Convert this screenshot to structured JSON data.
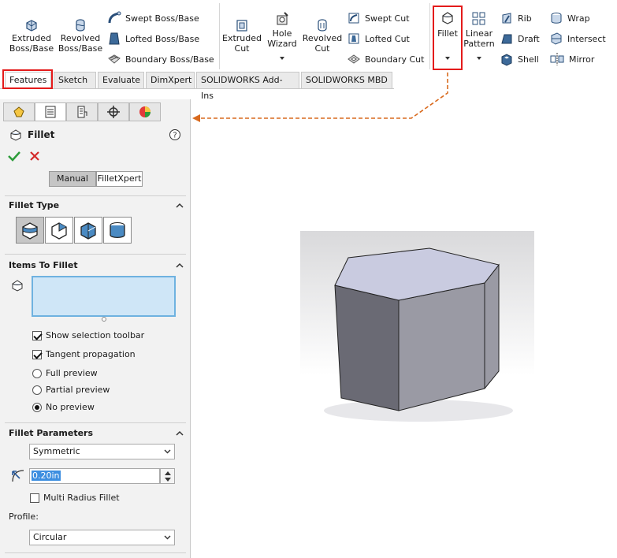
{
  "ribbon": {
    "extruded_boss": "Extruded\nBoss/Base",
    "revolved_boss": "Revolved\nBoss/Base",
    "swept_boss": "Swept Boss/Base",
    "lofted_boss": "Lofted Boss/Base",
    "boundary_boss": "Boundary Boss/Base",
    "extruded_cut": "Extruded\nCut",
    "hole_wizard": "Hole\nWizard",
    "revolved_cut": "Revolved\nCut",
    "swept_cut": "Swept Cut",
    "lofted_cut": "Lofted Cut",
    "boundary_cut": "Boundary Cut",
    "fillet": "Fillet",
    "linear_pattern": "Linear\nPattern",
    "rib": "Rib",
    "draft": "Draft",
    "shell": "Shell",
    "wrap": "Wrap",
    "intersect": "Intersect",
    "mirror": "Mirror"
  },
  "tabs": [
    "Features",
    "Sketch",
    "Evaluate",
    "DimXpert",
    "SOLIDWORKS Add-Ins",
    "SOLIDWORKS MBD"
  ],
  "panel": {
    "title": "Fillet",
    "mode_manual": "Manual",
    "mode_filletxpert": "FilletXpert",
    "fillet_type_header": "Fillet Type",
    "items_header": "Items To Fillet",
    "show_selection_toolbar": "Show selection toolbar",
    "tangent_propagation": "Tangent propagation",
    "full_preview": "Full preview",
    "partial_preview": "Partial preview",
    "no_preview": "No preview",
    "params_header": "Fillet Parameters",
    "symmetric": "Symmetric",
    "radius_value": "0.20in",
    "multi_radius": "Multi Radius Fillet",
    "profile_label": "Profile:",
    "profile_value": "Circular"
  },
  "colors": {
    "highlight_red": "#e41b1b",
    "arrow_orange": "#d96a1e",
    "selection_box_bg": "#cfe6f7",
    "selection_box_border": "#6fb2e0",
    "hex_top": "#c9cbe0",
    "hex_front": "#9a9aa4",
    "hex_side": "#6a6a74"
  }
}
